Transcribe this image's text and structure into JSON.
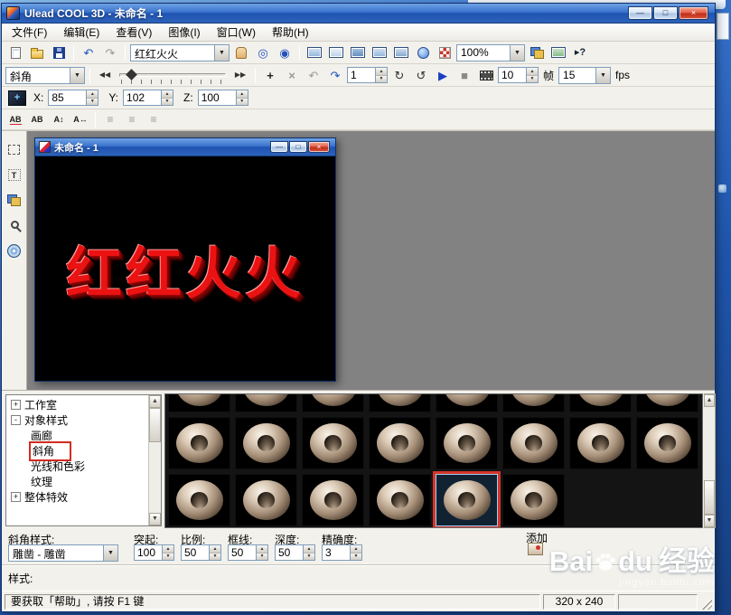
{
  "window": {
    "title": "Ulead COOL 3D - 未命名 - 1"
  },
  "menu_bar": {
    "items": [
      {
        "label": "文件(F)"
      },
      {
        "label": "编辑(E)"
      },
      {
        "label": "查看(V)"
      },
      {
        "label": "图像(I)"
      },
      {
        "label": "窗口(W)"
      },
      {
        "label": "帮助(H)"
      }
    ]
  },
  "standard_toolbar": {
    "text_preset_combo": "红红火火",
    "zoom_combo": "100%",
    "icons": [
      "new-document",
      "open-file",
      "save",
      "undo",
      "redo",
      "pan-hand",
      "orbit-view",
      "target-view",
      "window-mode-1",
      "window-mode-2",
      "window-mode-3",
      "window-mode-4",
      "window-mode-5",
      "web-globe",
      "texture-render",
      "object-manager",
      "browse-thumbnails",
      "context-help"
    ]
  },
  "animation_toolbar": {
    "attribute_combo": "斜角",
    "frame_value": "1",
    "speed_value": "10",
    "frames_label": "帧",
    "total_frames_combo": "15",
    "fps_label": "fps",
    "icons": [
      "first-frame",
      "timeline-slider",
      "last-frame",
      "add-keyframe",
      "delete-keyframe",
      "previous-keyframe",
      "next-keyframe",
      "loop-playback",
      "reverse-playback",
      "play",
      "stop",
      "export-video"
    ]
  },
  "position_toolbar": {
    "mode_icon": "move-object",
    "x_label": "X:",
    "x_value": "85",
    "y_label": "Y:",
    "y_value": "102",
    "z_label": "Z:",
    "z_value": "100"
  },
  "text_toolbar": {
    "icons": [
      "insert-text",
      "edit-text",
      "line-spacing",
      "kerning",
      "align-left",
      "align-center",
      "align-right"
    ]
  },
  "tool_palette": {
    "icons": [
      "edit-object",
      "text-tool",
      "insert-graphics",
      "zoom-tool",
      "media-disc"
    ]
  },
  "child_window": {
    "title": "未命名 - 1",
    "canvas_text": "红红火火"
  },
  "easy_palette": {
    "tree": {
      "items": [
        {
          "label": "工作室",
          "expander": "+"
        },
        {
          "label": "对象样式",
          "expander": "-"
        },
        {
          "label": "画廊"
        },
        {
          "label": "斜角",
          "annotated": true
        },
        {
          "label": "光线和色彩"
        },
        {
          "label": "纹理"
        },
        {
          "label": "整体特效",
          "expander": "+"
        }
      ]
    },
    "gallery": {
      "rows": [
        8,
        8,
        6
      ],
      "selected_row": 2,
      "selected_col": 4,
      "thumbnail_name": "bevel-style-torus"
    },
    "add_label": "添加"
  },
  "attribute_panel": {
    "bevel_style_label": "斜角样式:",
    "bevel_style_combo": "雕凿 - 雕凿",
    "fields": [
      {
        "label": "突起:",
        "value": "100"
      },
      {
        "label": "比例:",
        "value": "50"
      },
      {
        "label": "框线:",
        "value": "50"
      },
      {
        "label": "深度:",
        "value": "50"
      },
      {
        "label": "精确度:",
        "value": "3"
      }
    ],
    "style_label": "样式:"
  },
  "status_bar": {
    "message": "要获取「帮助」, 请按 F1 键",
    "canvas_size": "320 x 240"
  },
  "watermark": {
    "brand_left": "Bai",
    "brand_right": "du",
    "brand_suffix": "经验",
    "site": "jingyan.baidu.com",
    "colors": {
      "accent_blue": "#2f63ba",
      "annotation_red": "#d5342a",
      "text_red": "#ea1212"
    }
  }
}
